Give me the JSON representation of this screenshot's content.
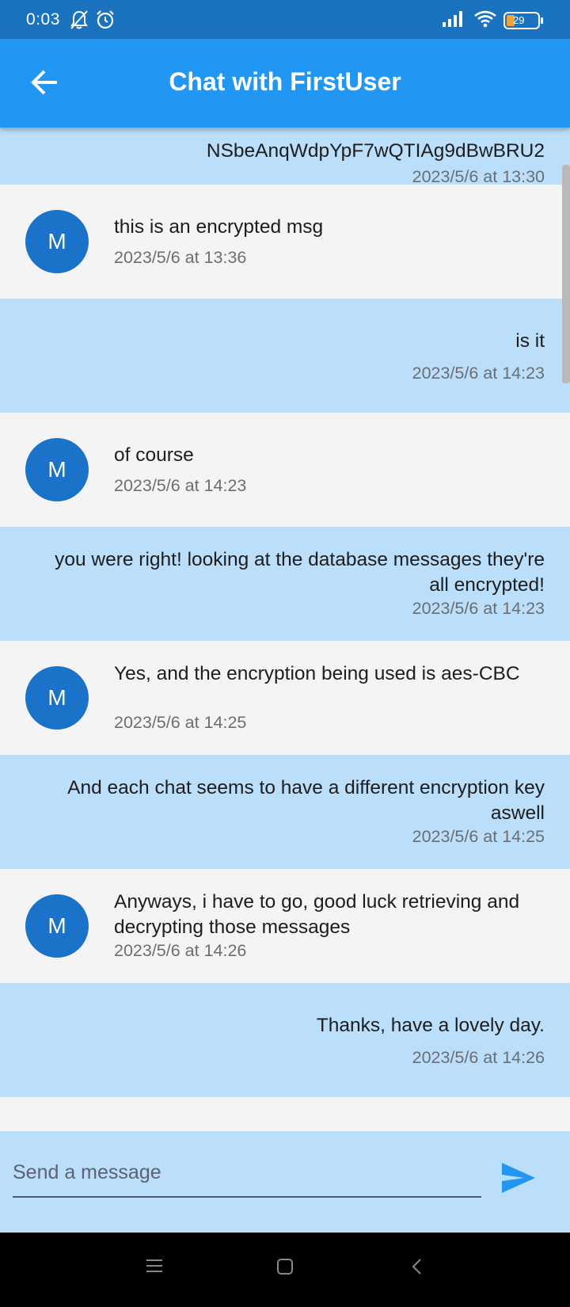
{
  "status_bar": {
    "time": "0:03",
    "battery": "29",
    "icons": [
      "bell-off-icon",
      "alarm-icon",
      "signal-icon",
      "wifi-icon",
      "battery-icon"
    ]
  },
  "app_bar": {
    "title": "Chat with FirstUser",
    "back_icon": "arrow-left-icon",
    "color": "#2196f3"
  },
  "messages": [
    {
      "direction": "sent",
      "text": "NSbeAnqWdpYpF7wQTIAg9dBwBRU2",
      "time": "2023/5/6 at 13:30"
    },
    {
      "direction": "received",
      "avatar": "M",
      "text": "this is an encrypted msg",
      "time": "2023/5/6 at 13:36"
    },
    {
      "direction": "sent",
      "text": "is it",
      "time": "2023/5/6 at 14:23"
    },
    {
      "direction": "received",
      "avatar": "M",
      "text": "of course",
      "time": "2023/5/6 at 14:23"
    },
    {
      "direction": "sent",
      "text": "you were right! looking at the database messages they're all encrypted!",
      "time": "2023/5/6 at 14:23"
    },
    {
      "direction": "received",
      "avatar": "M",
      "text": "Yes, and the encryption being used is aes-CBC",
      "time": "2023/5/6 at 14:25"
    },
    {
      "direction": "sent",
      "text": "And each chat seems to have a different encryption key aswell",
      "time": "2023/5/6 at 14:25"
    },
    {
      "direction": "received",
      "avatar": "M",
      "text": "Anyways, i have to go, good luck retrieving and decrypting those messages",
      "time": "2023/5/6 at 14:26"
    },
    {
      "direction": "sent",
      "text": "Thanks, have a lovely day.",
      "time": "2023/5/6 at 14:26"
    }
  ],
  "composer": {
    "placeholder": "Send a message",
    "value": "",
    "send_icon": "send-icon"
  },
  "colors": {
    "sent_bubble": "#bbdefb",
    "received_bubble": "#f4f4f5",
    "avatar": "#1b72c9",
    "status_bar": "#1b72bf"
  },
  "nav_bar": {
    "icons": [
      "menu-icon",
      "home-icon",
      "back-icon"
    ]
  }
}
